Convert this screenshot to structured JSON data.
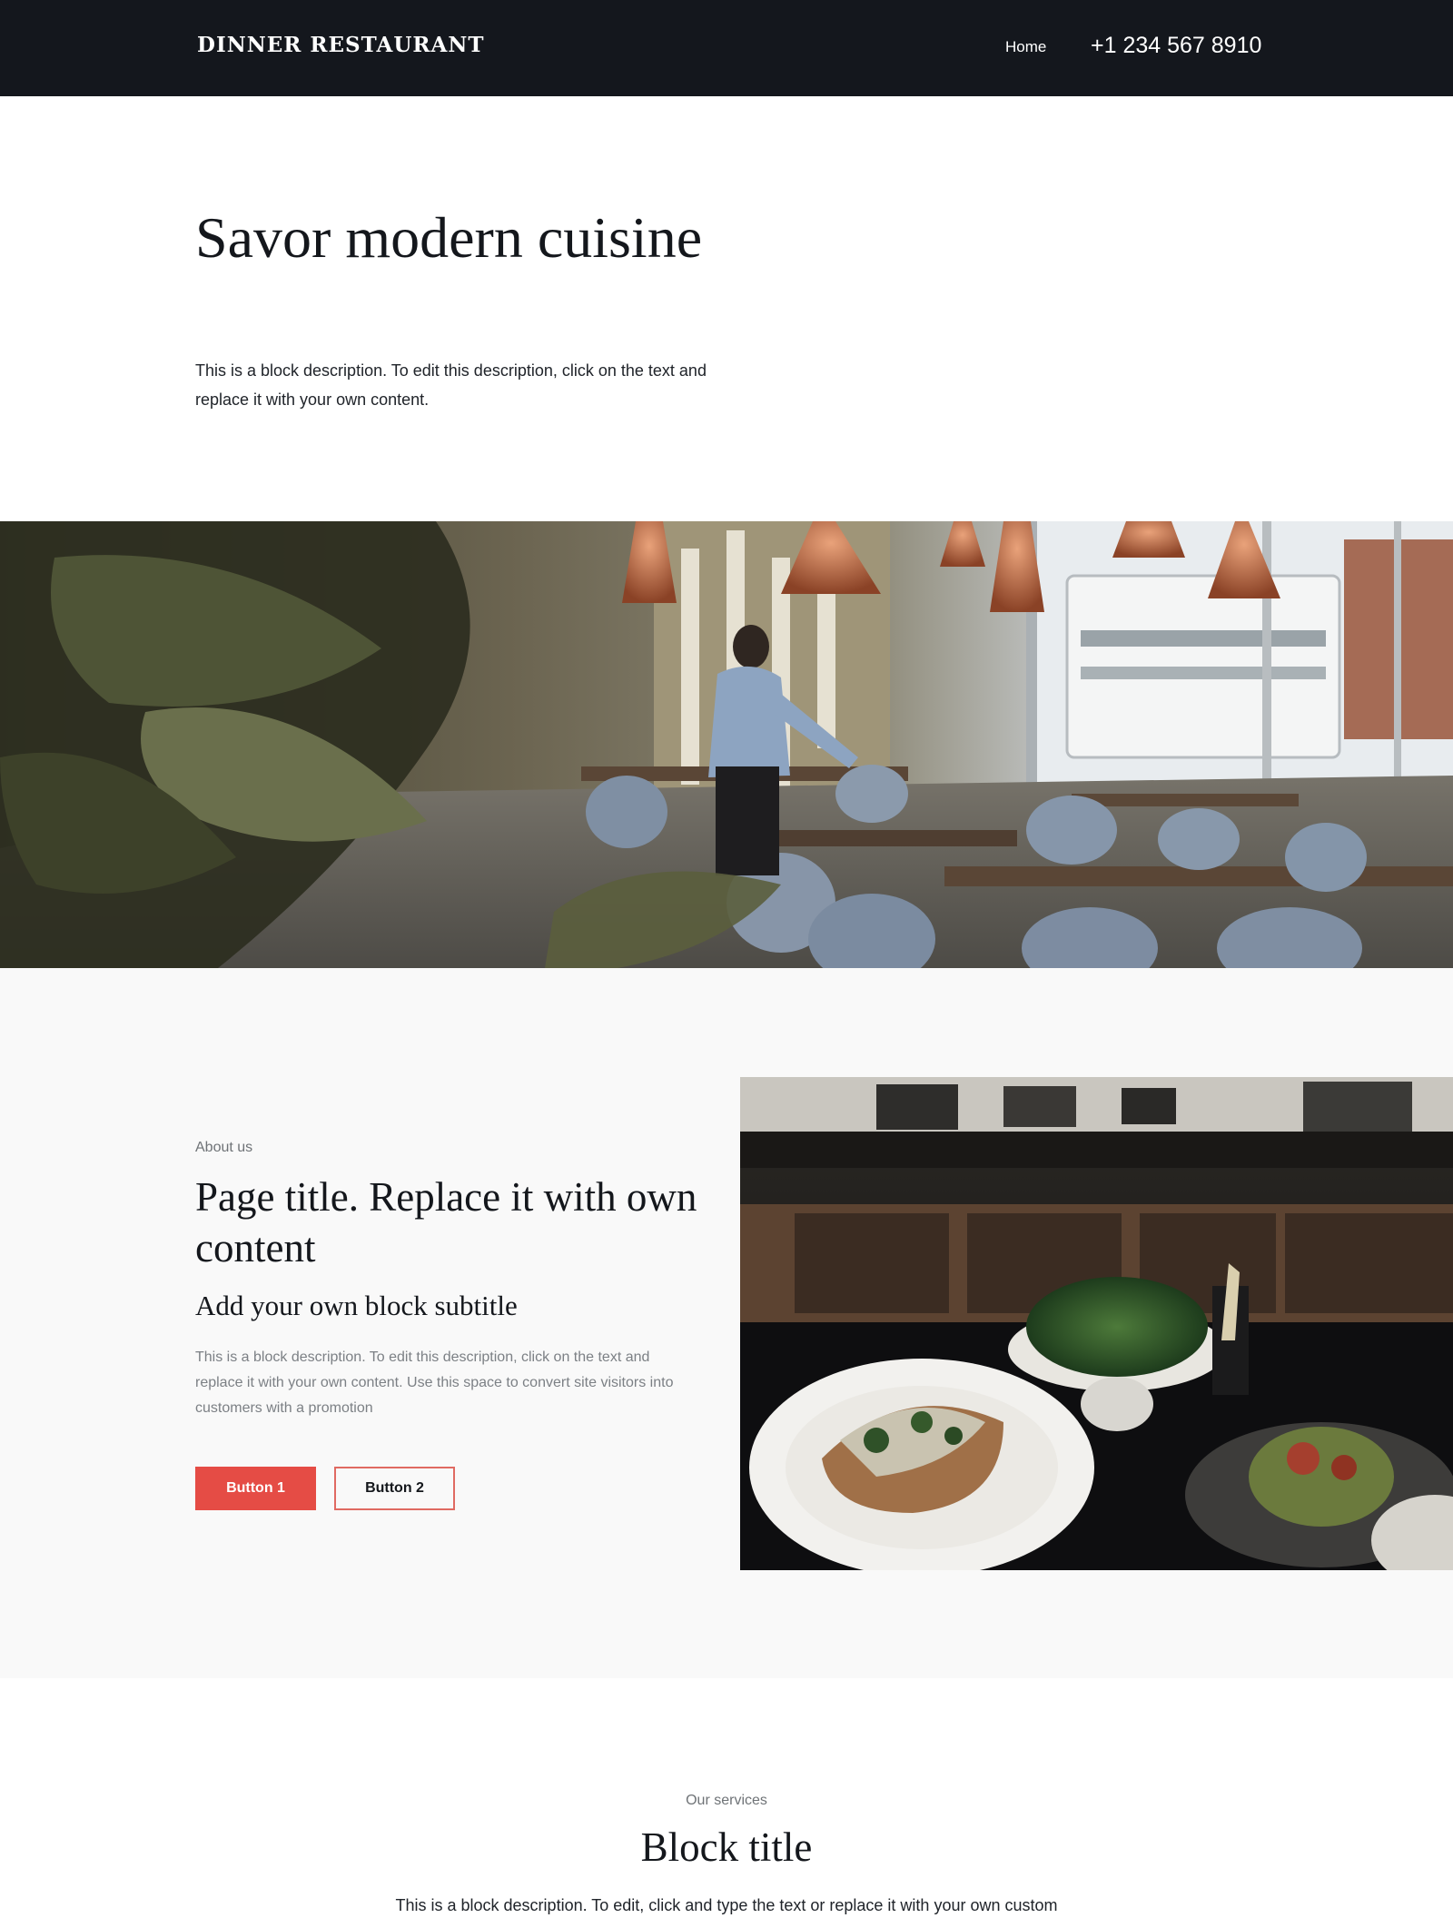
{
  "header": {
    "brand": "DINNER RESTAURANT",
    "nav_home": "Home",
    "phone": "+1 234 567 8910"
  },
  "hero": {
    "title": "Savor modern cuisine",
    "description": "This is a block description. To edit this description, click on the text and replace it with your own content."
  },
  "about": {
    "eyebrow": "About us",
    "title": "Page title. Replace it with own content",
    "subtitle": "Add your own block subtitle",
    "description": "This is a block description. To edit this description, click on the text and replace it with your own content. Use this space to convert site visitors into customers with a promotion",
    "button1": "Button 1",
    "button2": "Button 2"
  },
  "services": {
    "eyebrow": "Our services",
    "title": "Block title",
    "description": "This is a block description. To edit, click and type the text or replace it with your own custom"
  },
  "colors": {
    "header_bg": "#14171d",
    "accent": "#e54c45",
    "section_bg": "#f9f9f9"
  }
}
